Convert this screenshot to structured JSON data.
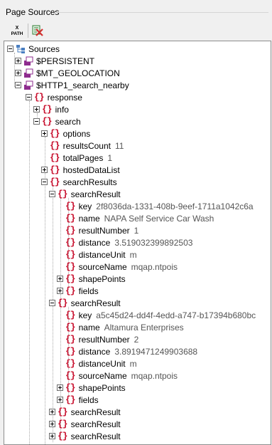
{
  "panel": {
    "title": "Page Sources"
  },
  "toolbar": {
    "xpath_icon": "xpath-icon",
    "clear_icon": "remove-filter-icon"
  },
  "tree": {
    "root": "Sources",
    "persistent": "$PERSISTENT",
    "geolocation": "$MT_GEOLOCATION",
    "http": "$HTTP1_search_nearby",
    "response": "response",
    "info": "info",
    "search": "search",
    "options": "options",
    "resultsCount": {
      "label": "resultsCount",
      "value": "11"
    },
    "totalPages": {
      "label": "totalPages",
      "value": "1"
    },
    "hostedDataList": "hostedDataList",
    "searchResults": "searchResults",
    "result1": {
      "label": "searchResult",
      "key": {
        "label": "key",
        "value": "2f8036da-1331-408b-9eef-1711a1042c6a"
      },
      "name": {
        "label": "name",
        "value": "NAPA Self Service Car Wash"
      },
      "resultNumber": {
        "label": "resultNumber",
        "value": "1"
      },
      "distance": {
        "label": "distance",
        "value": "3.519032399892503"
      },
      "distanceUnit": {
        "label": "distanceUnit",
        "value": "m"
      },
      "sourceName": {
        "label": "sourceName",
        "value": "mqap.ntpois"
      },
      "shapePoints": "shapePoints",
      "fields": "fields"
    },
    "result2": {
      "label": "searchResult",
      "key": {
        "label": "key",
        "value": "a5c45d24-dd4f-4edd-a747-b17394b680bc"
      },
      "name": {
        "label": "name",
        "value": "Altamura Enterprises"
      },
      "resultNumber": {
        "label": "resultNumber",
        "value": "2"
      },
      "distance": {
        "label": "distance",
        "value": "3.8919471249903688"
      },
      "distanceUnit": {
        "label": "distanceUnit",
        "value": "m"
      },
      "sourceName": {
        "label": "sourceName",
        "value": "mqap.ntpois"
      },
      "shapePoints": "shapePoints",
      "fields": "fields"
    },
    "result3": "searchResult",
    "result4": "searchResult",
    "result5": "searchResult"
  }
}
